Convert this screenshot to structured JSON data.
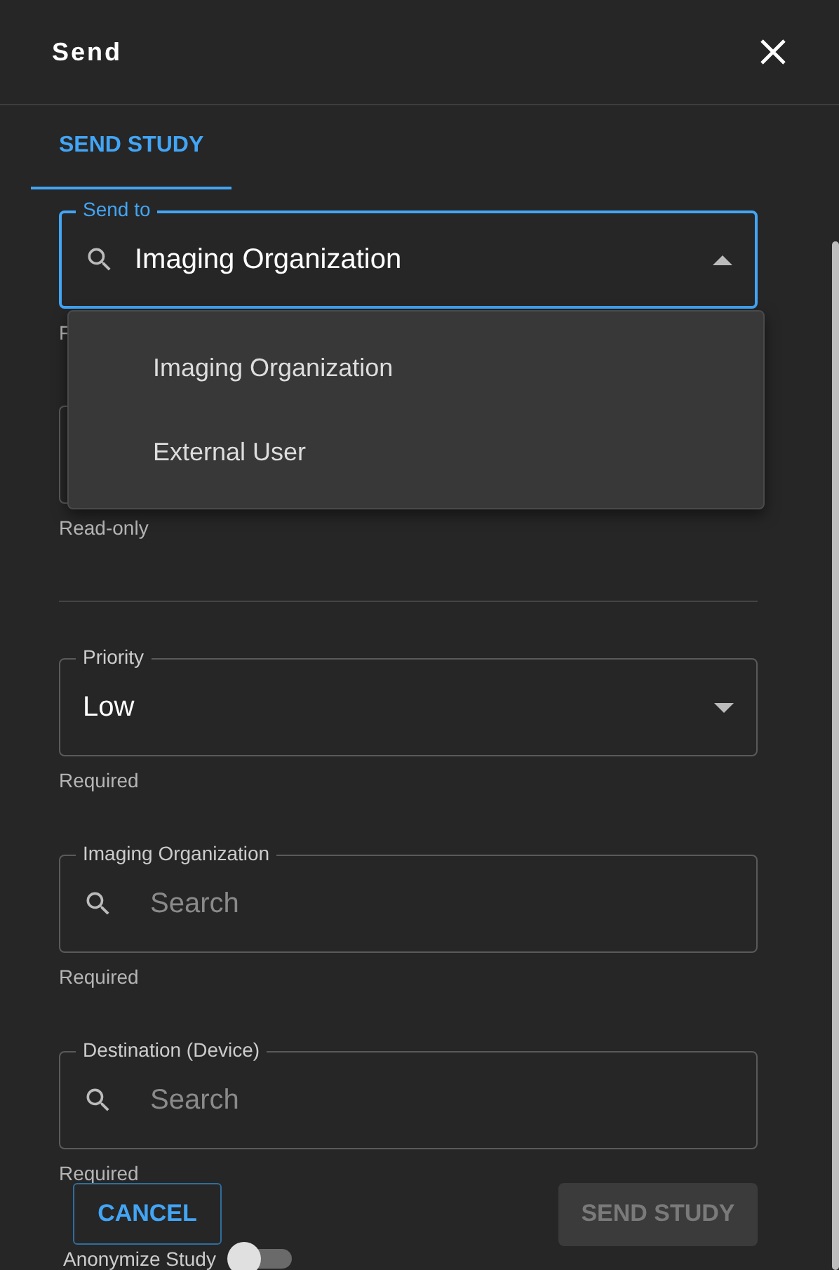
{
  "dialog": {
    "title": "Send"
  },
  "tabs": [
    {
      "label": "SEND STUDY",
      "selected": true
    }
  ],
  "send_to": {
    "label": "Send to",
    "value": "Imaging Organization",
    "focused": true,
    "expanded": true,
    "helper": "F"
  },
  "send_to_menu": [
    {
      "label": "Imaging Organization",
      "selected": false
    },
    {
      "label": "External User",
      "selected": false
    }
  ],
  "covered_field": {
    "helper": "Read-only"
  },
  "fields": [
    {
      "kind": "select",
      "label": "Priority",
      "value": "Low",
      "helper": "Required"
    },
    {
      "kind": "search",
      "label": "Imaging Organization",
      "placeholder": "Search",
      "helper": "Required"
    },
    {
      "kind": "search",
      "label": "Destination (Device)",
      "placeholder": "Search",
      "helper": "Required"
    }
  ],
  "buttons": [
    {
      "kind": "outline",
      "label": "CANCEL"
    },
    {
      "kind": "filled",
      "label": "SEND STUDY",
      "disabled": true
    }
  ],
  "anonymize": {
    "label": "Anonymize Study",
    "on": false
  }
}
